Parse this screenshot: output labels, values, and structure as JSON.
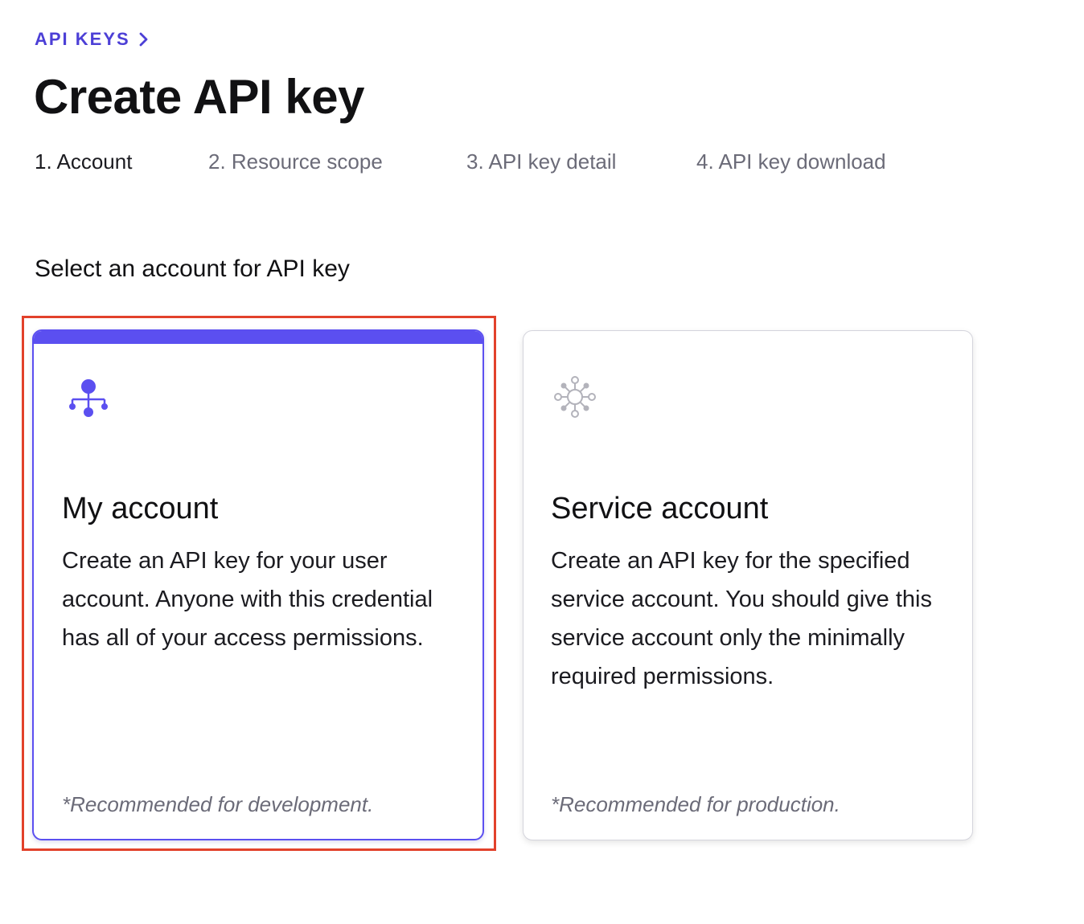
{
  "breadcrumb": {
    "label": "API KEYS",
    "chevron_icon": "chevron-right-icon"
  },
  "page": {
    "title": "Create API key"
  },
  "steps": [
    {
      "label": "1. Account",
      "active": true
    },
    {
      "label": "2. Resource scope",
      "active": false
    },
    {
      "label": "3. API key detail",
      "active": false
    },
    {
      "label": "4. API key download",
      "active": false
    }
  ],
  "section": {
    "heading": "Select an account for API key"
  },
  "cards": [
    {
      "icon": "hierarchy-icon",
      "title": "My account",
      "description": "Create an API key for your user account. Anyone with this credential has all of your access permissions.",
      "note": "*Recommended for development.",
      "selected": true
    },
    {
      "icon": "network-hub-icon",
      "title": "Service account",
      "description": "Create an API key for the specified service account. You should give this service account only the minimally required permissions.",
      "note": "*Recommended for production.",
      "selected": false
    }
  ],
  "colors": {
    "accent": "#5b4ff0",
    "breadcrumb": "#4c3fd6",
    "muted_text": "#6b6b78",
    "highlight_frame": "#e2412b",
    "icon_inactive": "#b3b3bb"
  }
}
